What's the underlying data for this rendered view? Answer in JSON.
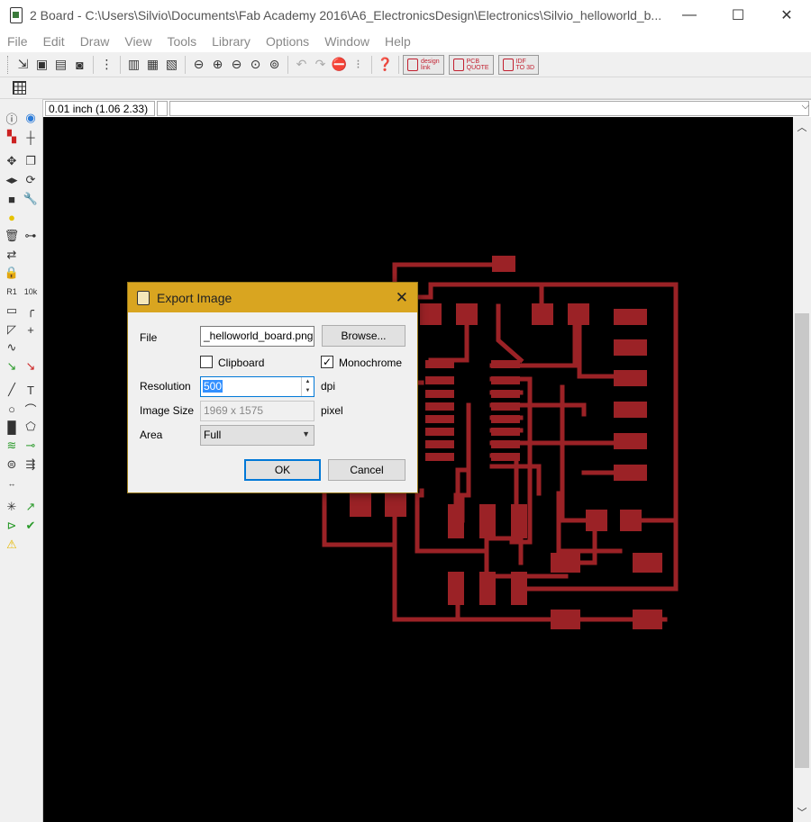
{
  "window": {
    "title": "2 Board - C:\\Users\\Silvio\\Documents\\Fab Academy 2016\\A6_ElectronicsDesign\\Electronics\\Silvio_helloworld_b...",
    "minimize": "—",
    "maximize": "☐",
    "close": "✕"
  },
  "menu": [
    "File",
    "Edit",
    "Draw",
    "View",
    "Tools",
    "Library",
    "Options",
    "Window",
    "Help"
  ],
  "toolbar": {
    "badges": [
      {
        "line1": "design",
        "line2": "link"
      },
      {
        "line1": "PCB",
        "line2": "QUOTE"
      },
      {
        "line1": "IDF",
        "line2": "TO 3D"
      }
    ]
  },
  "coords": {
    "display": "0.01 inch (1.06 2.33)",
    "command": ""
  },
  "dialog": {
    "title": "Export Image",
    "close": "✕",
    "file_label": "File",
    "file_value": "_helloworld_board.png",
    "browse_label": "Browse...",
    "clipboard_label": "Clipboard",
    "clipboard_checked": false,
    "monochrome_label": "Monochrome",
    "monochrome_checked": true,
    "check_mark": "✓",
    "resolution_label": "Resolution",
    "resolution_value": "500",
    "resolution_unit": "dpi",
    "image_size_label": "Image Size",
    "image_size_value": "1969 x 1575",
    "image_size_unit": "pixel",
    "area_label": "Area",
    "area_value": "Full",
    "ok_label": "OK",
    "cancel_label": "Cancel"
  },
  "colors": {
    "copper": "#9b2226",
    "canvas": "#000000",
    "dialog_title": "#d9a520"
  }
}
